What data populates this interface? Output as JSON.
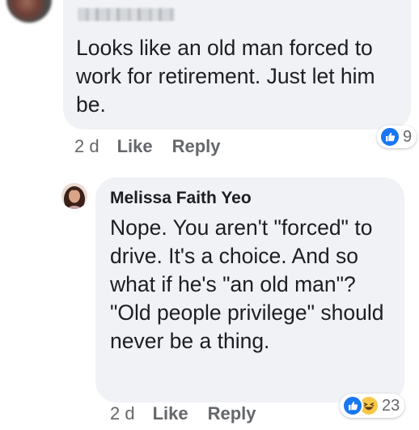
{
  "comments": [
    {
      "author": "",
      "text": "Looks like an old man forced to work for retirement. Just let him be.",
      "timestamp": "2 d",
      "like_label": "Like",
      "reply_label": "Reply",
      "reactions": {
        "icons": [
          "like-icon"
        ],
        "count": "9"
      }
    },
    {
      "author": "Melissa Faith Yeo",
      "text": "Nope. You aren't \"forced\" to drive. It's a choice. And so what if he's \"an old man\"? \"Old people privilege\" should never be a thing.",
      "timestamp": "2 d",
      "like_label": "Like",
      "reply_label": "Reply",
      "reactions": {
        "icons": [
          "like-icon",
          "haha-icon"
        ],
        "count": "23"
      }
    }
  ],
  "colors": {
    "bubble_bg": "#f0f2f5",
    "text": "#1c1e21",
    "meta_text": "#65676b",
    "like_blue": "#1877f2",
    "haha_yellow": "#f7c84a"
  }
}
